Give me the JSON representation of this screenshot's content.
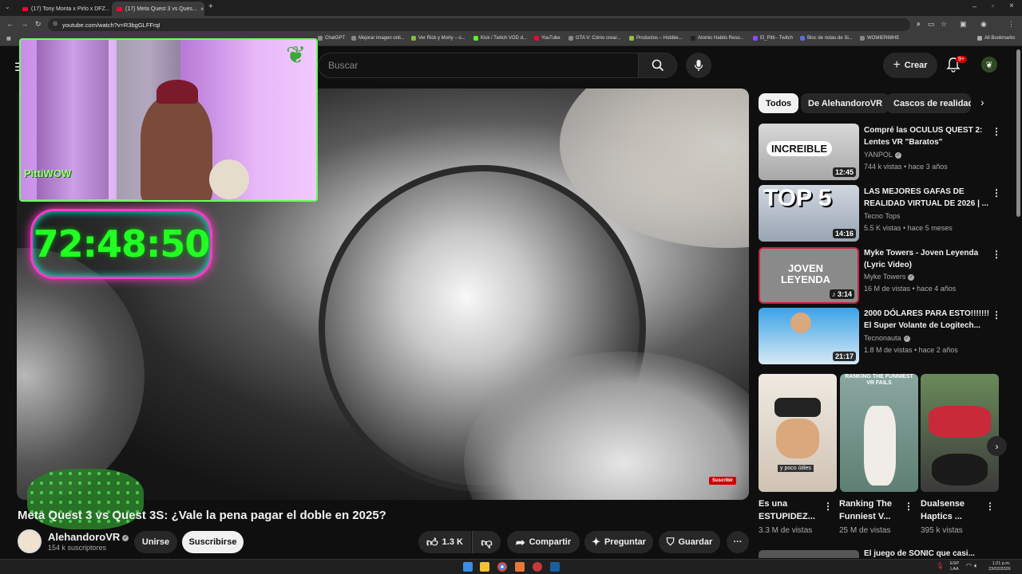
{
  "tabs": [
    {
      "title": "(17) Tony Monta x Pirlo x DFZ..."
    },
    {
      "title": "(17) Meta Quest 3 vs Ques..."
    }
  ],
  "url": "youtube.com/watch?v=R3bgGLFFrqI",
  "bookmarks": [
    "ChatGPT",
    "Mejorar imagen onli...",
    "Ver Rick y Morty – o...",
    "Kick / Twitch VOD d...",
    "YouTube",
    "GTA V: Cómo crear...",
    "Productos – Hobbie...",
    "Atomic Habits Reso...",
    "El_Pitti - Twitch",
    "Bloc de notas de Si...",
    "WOMIER68HE",
    "All Bookmarks"
  ],
  "header": {
    "search_placeholder": "Buscar",
    "create_label": "Crear",
    "notif_count": "9+"
  },
  "overlay": {
    "timer": "72:48:50",
    "cam_logo": "PittiWOW"
  },
  "player": {
    "watermark": "Suscribir"
  },
  "video": {
    "title": "Meta Quest 3 vs Quest 3S: ¿Vale la pena pagar el doble en 2025?",
    "channel_name": "AlehandoroVR",
    "subscribers": "154 k suscriptores",
    "join_label": "Unirse",
    "subscribe_label": "Suscribirse",
    "likes": "1.3 K",
    "share_label": "Compartir",
    "ask_label": "Preguntar",
    "save_label": "Guardar"
  },
  "chips": [
    "Todos",
    "De AlehandoroVR",
    "Cascos de realidad"
  ],
  "recommendations": [
    {
      "title": "Compré las OCULUS QUEST 2: Lentes VR \"Baratos\"",
      "channel": "YANPOL",
      "verified": true,
      "meta": "744 k vistas • hace 3 años",
      "duration": "12:45",
      "thumb_text": "INCREIBLE"
    },
    {
      "title": "LAS MEJORES GAFAS DE REALIDAD VIRTUAL DE 2026 | ...",
      "channel": "Tecno Tops",
      "verified": false,
      "meta": "5.5 K vistas • hace 5 meses",
      "duration": "14:16",
      "thumb_text": "TOP 5"
    },
    {
      "title": "Myke Towers - Joven Leyenda (Lyric Video)",
      "channel": "Myke Towers",
      "verified": true,
      "meta": "16 M de vistas • hace 4 años",
      "duration": "3:14",
      "thumb_text": "JOVEN LEYENDA"
    },
    {
      "title": "2000 DÓLARES PARA ESTO!!!!!!! El Super Volante de Logitech...",
      "channel": "Tecnonauta",
      "verified": true,
      "meta": "1.8 M de vistas • hace 2 años",
      "duration": "21:17",
      "thumb_text": ""
    }
  ],
  "shorts": [
    {
      "title": "Es una ESTUPIDEZ...",
      "views": "3.3 M de vistas",
      "thumb_text": "y poco útiles"
    },
    {
      "title": "Ranking The Funniest V...",
      "views": "25 M de vistas",
      "thumb_text": "RANKING THE FUNNIEST VR FAILS"
    },
    {
      "title": "Dualsense Haptics ...",
      "views": "395 k vistas",
      "thumb_text": ""
    }
  ],
  "next_partial": "El juego de SONIC que casi...",
  "taskbar": {
    "lang_1": "ESP",
    "lang_2": "LAA",
    "time": "1:21 p.m.",
    "date": "23/02/2026"
  }
}
